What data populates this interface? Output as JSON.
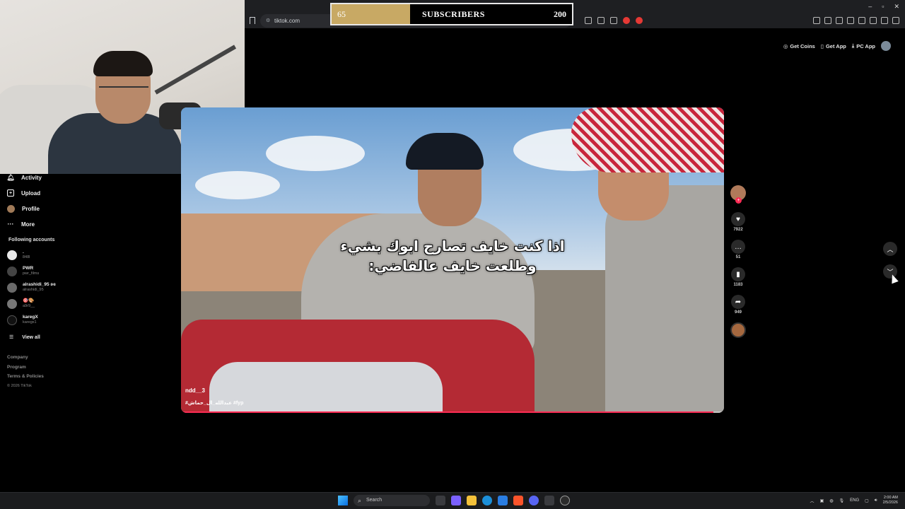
{
  "browser": {
    "url": "tiktok.com",
    "window_controls": [
      "–",
      "▫",
      "✕"
    ]
  },
  "subscribers_overlay": {
    "current": "65",
    "label": "SUBSCRIBERS",
    "goal": "200",
    "progress_fraction": 0.325,
    "fill_color": "#c8a964"
  },
  "header": {
    "get_coins": "Get Coins",
    "get_app": "Get App",
    "pc_app": "PC App"
  },
  "sidebar": {
    "items": [
      {
        "label": "Activity",
        "icon": "bell-icon"
      },
      {
        "label": "Upload",
        "icon": "plus-box-icon"
      },
      {
        "label": "Profile",
        "icon": "avatar-icon"
      },
      {
        "label": "More",
        "icon": "ellipsis-icon"
      }
    ],
    "following_header": "Following accounts",
    "accounts": [
      {
        "name": ".",
        "username": "848l"
      },
      {
        "name": "PWR",
        "username": "pwr_films"
      },
      {
        "name": "alrashidi_95 ʚɞ",
        "username": "alrashidi_95"
      },
      {
        "name": "🎯🎨",
        "username": "a9r9__"
      },
      {
        "name": "karegX",
        "username": "karegx1"
      }
    ],
    "view_all": "View all",
    "footer": {
      "company": "Company",
      "program": "Program",
      "terms": "Terms & Policies",
      "copyright": "© 2026 TikTok"
    }
  },
  "video": {
    "caption_line1": "اذا كنت خايف تصارح ابوك بشيء",
    "caption_line2": "وطلعت خايف عالفاضي:",
    "username": "ndd__3",
    "tags": "#عبدالله_ال_حماش #fyp",
    "progress_fraction": 0.98
  },
  "actions": {
    "likes": "7922",
    "comments": "51",
    "bookmarks": "1183",
    "shares": "949"
  },
  "taskbar": {
    "search_placeholder": "Search",
    "language": "ENG",
    "time": "2:00 AM",
    "date": "2/5/2026"
  },
  "colors": {
    "accent": "#fe2c55",
    "background": "#000000"
  }
}
